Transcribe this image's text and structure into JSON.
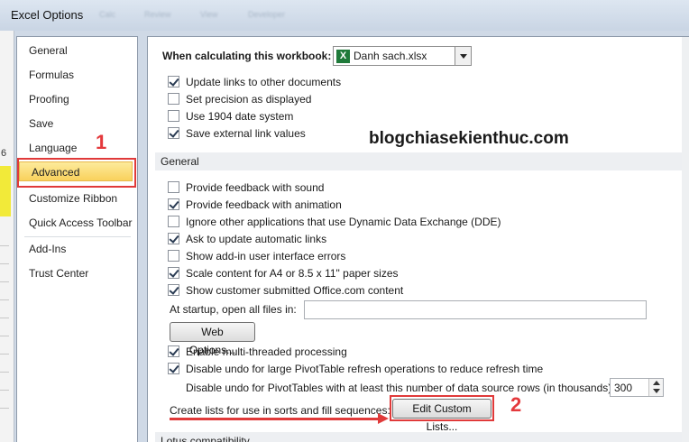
{
  "window": {
    "title": "Excel Options",
    "ghost_tabs": [
      "Calc",
      "Review",
      "View",
      "Developer"
    ]
  },
  "left_strip": {
    "row_number": "6"
  },
  "nav": {
    "items": [
      {
        "label": "General"
      },
      {
        "label": "Formulas"
      },
      {
        "label": "Proofing"
      },
      {
        "label": "Save"
      },
      {
        "label": "Language"
      },
      {
        "label": "Advanced"
      },
      {
        "label": "Customize Ribbon"
      },
      {
        "label": "Quick Access Toolbar"
      },
      {
        "label": "Add-Ins"
      },
      {
        "label": "Trust Center"
      }
    ],
    "active": "Advanced"
  },
  "annotations": {
    "marker1": "1",
    "marker2": "2",
    "watermark": "blogchiasekienthuc.com"
  },
  "workbook_section": {
    "label": "When calculating this workbook:",
    "selected_workbook": "Danh sach.xlsx",
    "options": [
      {
        "label": "Update links to other documents",
        "checked": true
      },
      {
        "label": "Set precision as displayed",
        "checked": false
      },
      {
        "label": "Use 1904 date system",
        "checked": false
      },
      {
        "label": "Save external link values",
        "checked": true
      }
    ]
  },
  "general_section": {
    "header": "General",
    "options": [
      {
        "label": "Provide feedback with sound",
        "checked": false
      },
      {
        "label": "Provide feedback with animation",
        "checked": true
      },
      {
        "label": "Ignore other applications that use Dynamic Data Exchange (DDE)",
        "checked": false
      },
      {
        "label": "Ask to update automatic links",
        "checked": true
      },
      {
        "label": "Show add-in user interface errors",
        "checked": false
      },
      {
        "label": "Scale content for A4 or 8.5 x 11\" paper sizes",
        "checked": true
      },
      {
        "label": "Show customer submitted Office.com content",
        "checked": true
      }
    ],
    "startup_label": "At startup, open all files in:",
    "startup_value": "",
    "web_options_label": "Web Options...",
    "options2": [
      {
        "label": "Enable multi-threaded processing",
        "checked": true
      },
      {
        "label": "Disable undo for large PivotTable refresh operations to reduce refresh time",
        "checked": true
      }
    ],
    "undo_rows_label": "Disable undo for PivotTables with at least this number of data source rows (in thousands):",
    "undo_rows_value": "300",
    "custom_lists_label": "Create lists for use in sorts and fill sequences:",
    "edit_custom_lists_label": "Edit Custom Lists..."
  },
  "lotus_section": {
    "header": "Lotus compatibility"
  }
}
